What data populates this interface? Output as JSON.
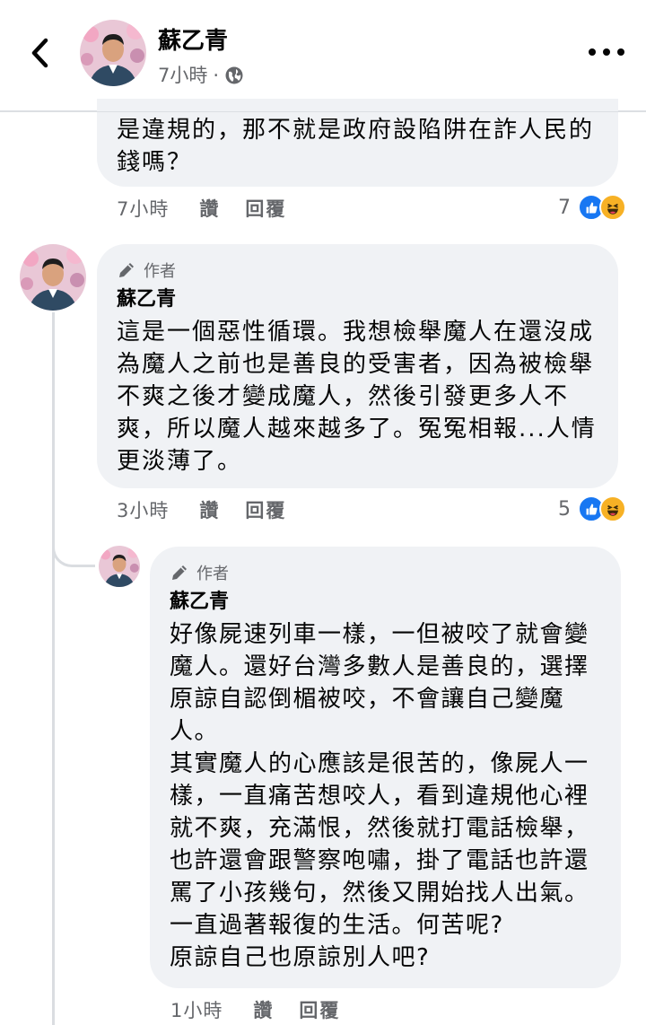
{
  "header": {
    "name": "蘇乙青",
    "time": "7小時",
    "dot": "·"
  },
  "comment0": {
    "text": "是違規的，那不就是政府設陷阱在詐人民的\n錢嗎？",
    "time": "7小時",
    "like_label": "讚",
    "reply_label": "回覆",
    "reaction_count": "7"
  },
  "comment1": {
    "badge": "作者",
    "name": "蘇乙青",
    "text": "這是一個惡性循環。我想檢舉魔人在還沒成\n為魔人之前也是善良的受害者，因為被檢舉\n不爽之後才變成魔人，然後引發更多人不\n爽，所以魔人越來越多了。冤冤相報...人情\n更淡薄了。",
    "time": "3小時",
    "like_label": "讚",
    "reply_label": "回覆",
    "reaction_count": "5"
  },
  "comment2": {
    "badge": "作者",
    "name": "蘇乙青",
    "text": "好像屍速列車一樣，一但被咬了就會變\n魔人。還好台灣多數人是善良的，選擇\n原諒自認倒楣被咬，不會讓自己變魔\n人。\n其實魔人的心應該是很苦的，像屍人一\n樣，一直痛苦想咬人，看到違規他心裡\n就不爽，充滿恨，然後就打電話檢舉，\n也許還會跟警察咆嘯，掛了電話也許還\n罵了小孩幾句，然後又開始找人出氣。\n一直過著報復的生活。何苦呢?\n原諒自己也原諒別人吧?",
    "time": "1小時",
    "like_label": "讚",
    "reply_label": "回覆"
  },
  "colors": {
    "like_blue": "#1877f2",
    "haha_yellow": "#f7b125",
    "bubble_bg": "#f0f2f5",
    "meta_gray": "#65676b"
  },
  "icons": [
    "back-chevron-icon",
    "globe-icon",
    "more-icon",
    "pencil-icon",
    "like-icon",
    "haha-icon"
  ]
}
